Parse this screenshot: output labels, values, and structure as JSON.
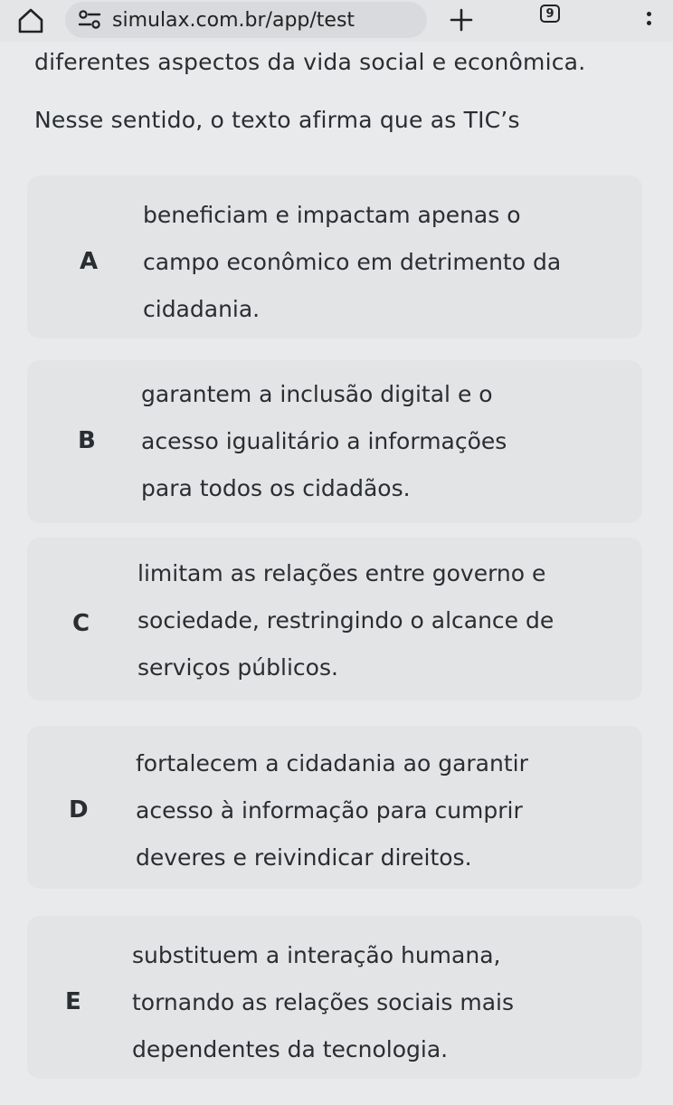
{
  "browser": {
    "url": "simulax.com.br/app/test",
    "tab_count": "9"
  },
  "question": {
    "stem_line_1": "diferentes aspectos da vida social e econômica.",
    "stem_line_2": "Nesse sentido, o texto afirma que as TIC’s"
  },
  "options": [
    {
      "letter": "A",
      "text": "beneficiam e impactam apenas o\ncampo econômico em detrimento da\ncidadania."
    },
    {
      "letter": "B",
      "text": "garantem a inclusão digital e o\nacesso igualitário a informações\npara todos os cidadãos."
    },
    {
      "letter": "C",
      "text": "limitam as relações entre governo e\nsociedade, restringindo o alcance de\nserviços públicos."
    },
    {
      "letter": "D",
      "text": "fortalecem a cidadania ao garantir\nacesso à informação para cumprir\ndeveres e reivindicar direitos."
    },
    {
      "letter": "E",
      "text": "substituem a interação humana,\ntornando as relações sociais mais\ndependentes da tecnologia."
    }
  ]
}
